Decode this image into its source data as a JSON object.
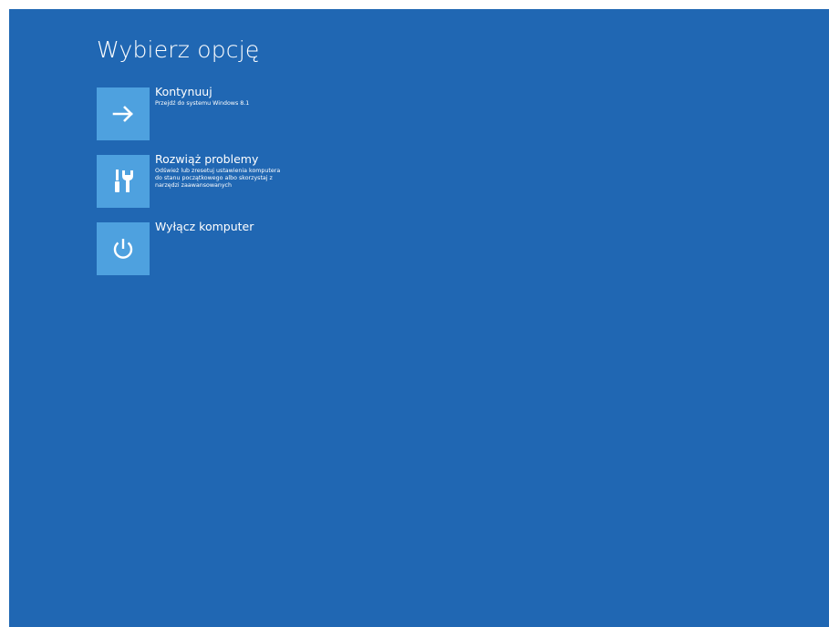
{
  "screen": {
    "title": "Wybierz opcję",
    "background_color": "#2067b3",
    "tile_color": "#4ea1df"
  },
  "options": [
    {
      "icon": "arrow-right-icon",
      "label": "Kontynuuj",
      "description": "Przejdź do systemu Windows 8.1"
    },
    {
      "icon": "tools-icon",
      "label": "Rozwiąż problemy",
      "description": "Odśwież lub zresetuj ustawienia komputera do stanu początkowego albo skorzystaj z narzędzi zaawansowanych"
    },
    {
      "icon": "power-icon",
      "label": "Wyłącz komputer",
      "description": ""
    }
  ]
}
